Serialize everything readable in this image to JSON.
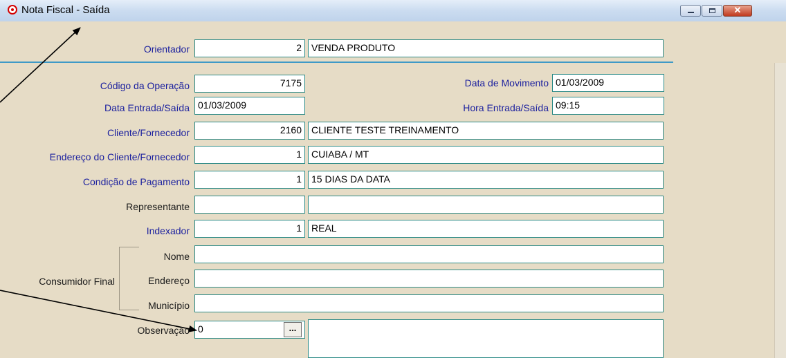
{
  "window": {
    "title": "Nota Fiscal - Saída",
    "close_glyph": "✕"
  },
  "header": {
    "orientador_label": "Orientador",
    "orientador_code": "2",
    "orientador_desc": "VENDA PRODUTO"
  },
  "form": {
    "codigo_operacao": {
      "label": "Código da Operação",
      "value": "7175"
    },
    "data_movimento": {
      "label": "Data de Movimento",
      "value": "01/03/2009"
    },
    "data_entrada_saida": {
      "label": "Data Entrada/Saída",
      "value": "01/03/2009"
    },
    "hora_entrada_saida": {
      "label": "Hora Entrada/Saída",
      "value": "09:15"
    },
    "cliente_fornecedor": {
      "label": "Cliente/Fornecedor",
      "code": "2160",
      "desc": "CLIENTE TESTE TREINAMENTO"
    },
    "endereco_cliente": {
      "label": "Endereço do Cliente/Fornecedor",
      "code": "1",
      "desc": "CUIABA / MT"
    },
    "condicao_pagamento": {
      "label": "Condição de Pagamento",
      "code": "1",
      "desc": "15 DIAS DA DATA"
    },
    "representante": {
      "label": "Representante",
      "code": "",
      "desc": ""
    },
    "indexador": {
      "label": "Indexador",
      "code": "1",
      "desc": "REAL"
    },
    "consumidor_final": {
      "group_label": "Consumidor Final",
      "nome_label": "Nome",
      "nome": "",
      "endereco_label": "Endereço",
      "endereco": "",
      "municipio_label": "Município",
      "municipio": ""
    },
    "observacao": {
      "label": "Observação",
      "code": "0",
      "button": "...",
      "text": ""
    }
  },
  "colors": {
    "label_blue": "#1a1f9e",
    "field_border": "#2b8a86",
    "background": "#e6dcc6",
    "separator": "#3f9ac7"
  },
  "icons": [
    "app-icon",
    "minimize-icon",
    "maximize-icon",
    "close-icon",
    "ellipsis-icon"
  ]
}
